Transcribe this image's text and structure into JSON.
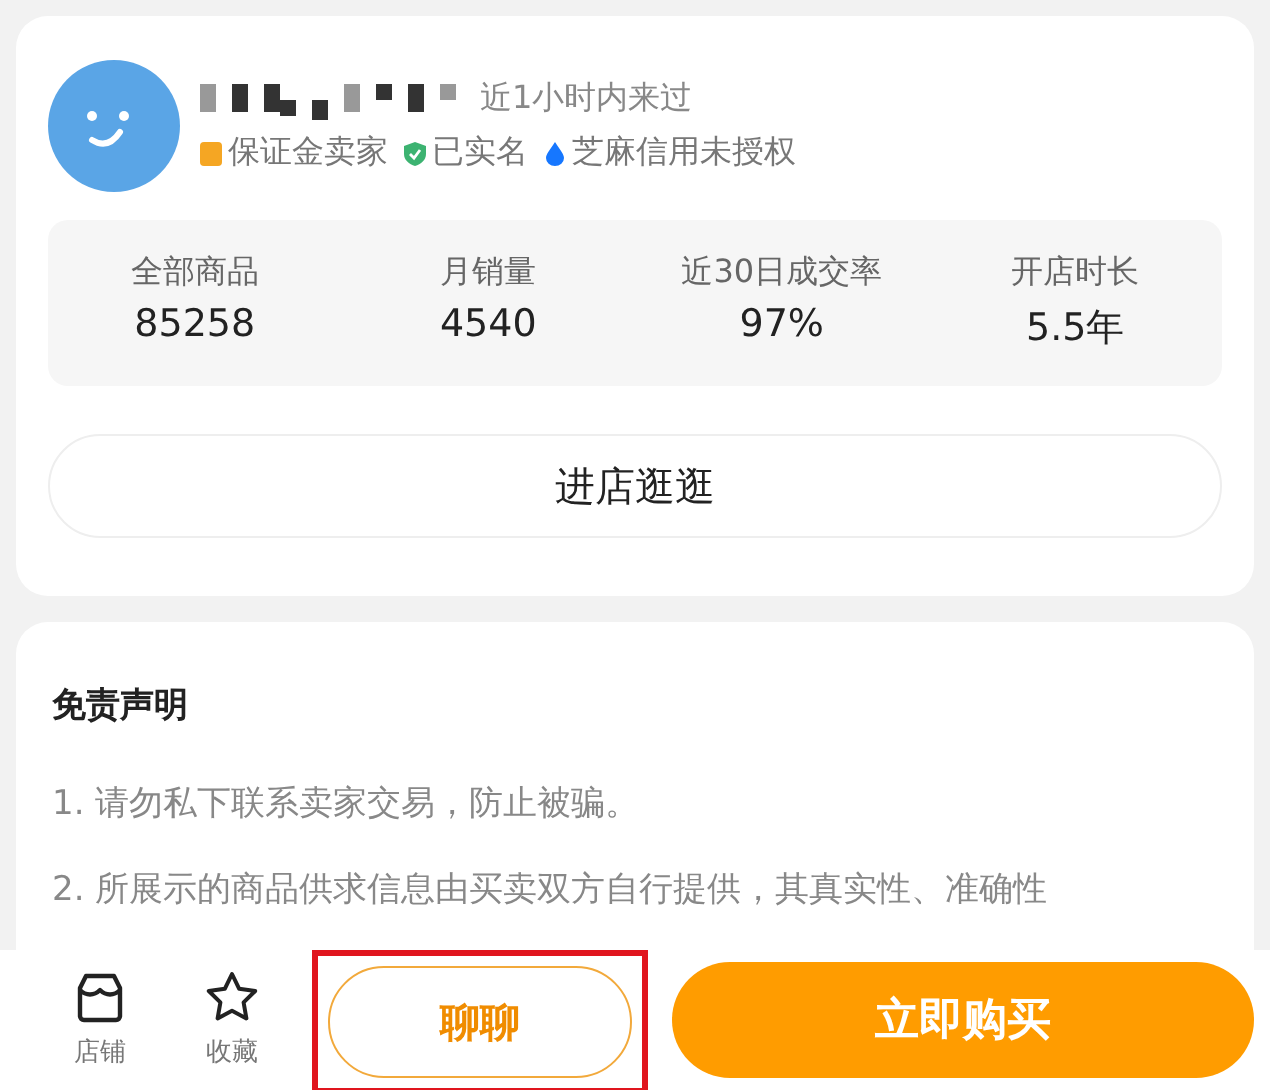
{
  "seller": {
    "last_seen": "近1小时内来过",
    "badges": [
      {
        "kind": "deposit",
        "label": "保证金卖家",
        "color": "#f5a623"
      },
      {
        "kind": "verified",
        "label": "已实名",
        "color": "#3cb371"
      },
      {
        "kind": "credit",
        "label": "芝麻信用未授权",
        "color": "#1677ff"
      }
    ]
  },
  "stats": [
    {
      "label": "全部商品",
      "value": "85258"
    },
    {
      "label": "月销量",
      "value": "4540"
    },
    {
      "label": "近30日成交率",
      "value": "97%"
    },
    {
      "label": "开店时长",
      "value": "5.5年"
    }
  ],
  "visit_button": "进店逛逛",
  "disclaimer": {
    "title": "免责声明",
    "items": [
      "1. 请勿私下联系卖家交易，防止被骗。",
      "2. 所展示的商品供求信息由买卖双方自行提供，其真实性、准确性"
    ]
  },
  "bottom_bar": {
    "actions": [
      {
        "kind": "store",
        "label": "店铺"
      },
      {
        "kind": "favorite",
        "label": "收藏"
      }
    ],
    "chat_button": {
      "label": "聊聊",
      "highlighted": true
    },
    "buy_button": "立即购买"
  }
}
